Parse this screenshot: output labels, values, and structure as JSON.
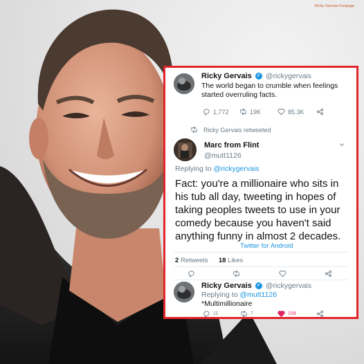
{
  "watermark": "Ricky Gervais Fanpage",
  "tweet1": {
    "name": "Ricky Gervais",
    "handle": "@rickygervais",
    "text_line1": "The world began to crumble when feelings",
    "text_line2": "started overruling facts.",
    "replies": "1,772",
    "retweets": "19K",
    "likes": "85.3K"
  },
  "retweeted_label": "Ricky Gervais retweeted",
  "tweet2": {
    "name": "Marc from Flint",
    "handle": "@mutt1126",
    "replying_prefix": "Replying to",
    "replying_to": "@rickygervais",
    "text_line1": "Fact: you're a millionaire who sits in",
    "text_line2": "his tub all day, tweeting in hopes of",
    "text_line3": "taking peoples tweets to use in your",
    "text_line4": "comedy because you haven't said",
    "text_line5": "anything funny in almost 2 decades.",
    "source": "Twitter for Android",
    "retweet_count": "2",
    "retweet_label": "Retweets",
    "like_count": "18",
    "like_label": "Likes"
  },
  "tweet3": {
    "name": "Ricky Gervais",
    "handle": "@rickygervais",
    "replying_prefix": "Replying to",
    "replying_to": "@mutt1126",
    "text": "*Multimillionaire",
    "replies": "11",
    "retweets": "7",
    "likes": "159"
  },
  "colors": {
    "border": "#e3232a",
    "link": "#1b95e0",
    "like_active": "#e0245e"
  },
  "icons": [
    "reply-icon",
    "retweet-icon",
    "heart-icon",
    "share-icon",
    "verified-icon",
    "chevron-down-icon"
  ]
}
